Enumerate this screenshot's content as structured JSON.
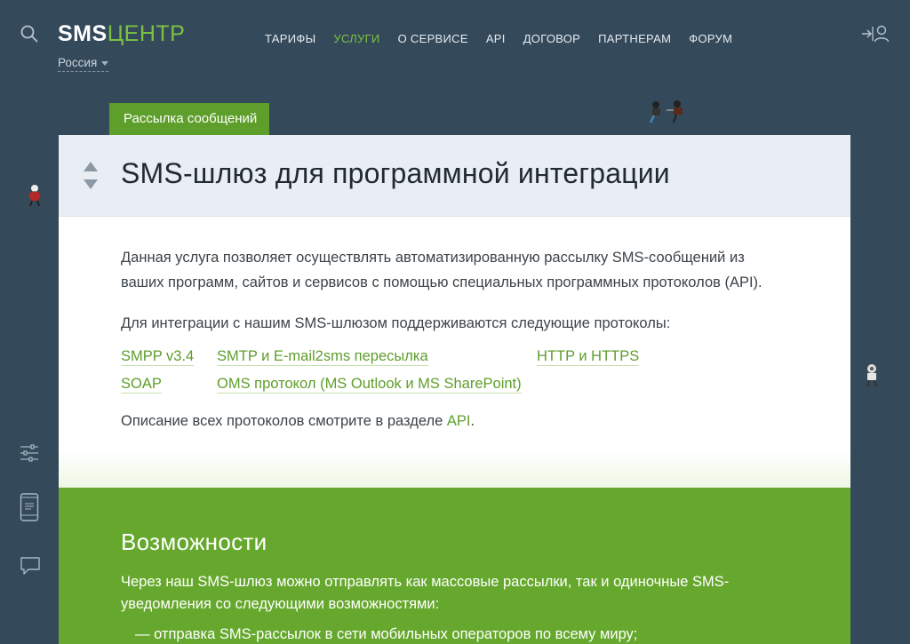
{
  "header": {
    "logo_part1": "SMS",
    "logo_part2": "ЦЕНТР",
    "region": "Россия",
    "nav": [
      {
        "label": "ТАРИФЫ",
        "active": false
      },
      {
        "label": "УСЛУГИ",
        "active": true
      },
      {
        "label": "О СЕРВИСЕ",
        "active": false
      },
      {
        "label": "API",
        "active": false
      },
      {
        "label": "ДОГОВОР",
        "active": false
      },
      {
        "label": "ПАРТНЕРАМ",
        "active": false
      },
      {
        "label": "ФОРУМ",
        "active": false
      }
    ]
  },
  "tab": {
    "label": "Рассылка сообщений"
  },
  "card": {
    "title": "SMS-шлюз для программной интеграции",
    "intro": "Данная услуга позволяет осуществлять автоматизированную рассылку SMS-сообщений из ваших программ, сайтов и сервисов с помощью специальных программных протоколов (API).",
    "protocols_intro": "Для интеграции с нашим SMS-шлюзом поддерживаются следующие протоколы:",
    "protocols": [
      {
        "label": "SMPP v3.4"
      },
      {
        "label": "SMTP и E-mail2sms пересылка"
      },
      {
        "label": "HTTP и HTTPS"
      },
      {
        "label": "SOAP"
      },
      {
        "label": "OMS протокол (MS Outlook и MS SharePoint)"
      }
    ],
    "description_prefix": "Описание всех протоколов смотрите в разделе ",
    "description_link": "API",
    "description_suffix": "."
  },
  "features": {
    "heading": "Возможности",
    "text": "Через наш SMS-шлюз можно отправлять как массовые рассылки, так и одиночные SMS-уведомления со следующими возможностями:",
    "items": [
      "— отправка SMS-рассылок в сети мобильных операторов по всему миру;"
    ]
  },
  "colors": {
    "background": "#34495a",
    "accent": "#7cc242",
    "tab": "#5e9e2b",
    "green_section": "#66a82d",
    "card_header": "#e8eef4"
  },
  "icons": {
    "search": "search-icon",
    "login": "login-icon",
    "settings": "sliders-icon",
    "mobile": "mobile-phone-icon",
    "chat": "chat-icon"
  }
}
